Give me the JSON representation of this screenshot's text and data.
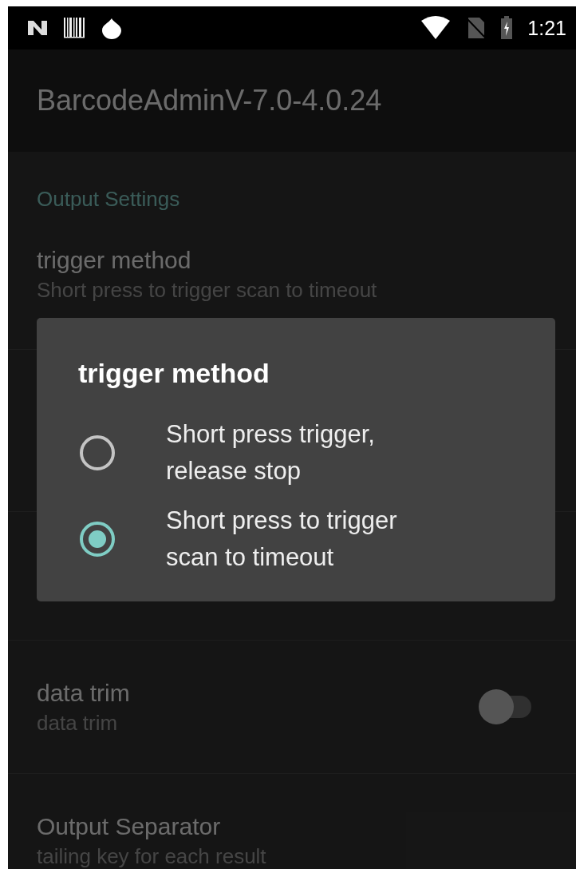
{
  "status_bar": {
    "time": "1:21"
  },
  "app_bar": {
    "title": "BarcodeAdminV-7.0-4.0.24"
  },
  "settings": {
    "category": "Output Settings",
    "items": [
      {
        "kind": "text",
        "title": "trigger method",
        "summary": "Short press to trigger scan to timeout"
      },
      {
        "kind": "switch",
        "title": "data trim",
        "summary": "data trim",
        "on": false
      },
      {
        "kind": "text",
        "title": "Output Separator",
        "summary": "tailing key for each result"
      }
    ]
  },
  "dialog": {
    "title": "trigger method",
    "options": [
      {
        "label": "Short press trigger, release stop",
        "selected": false
      },
      {
        "label": "Short press to trigger scan to timeout",
        "selected": true
      }
    ]
  }
}
